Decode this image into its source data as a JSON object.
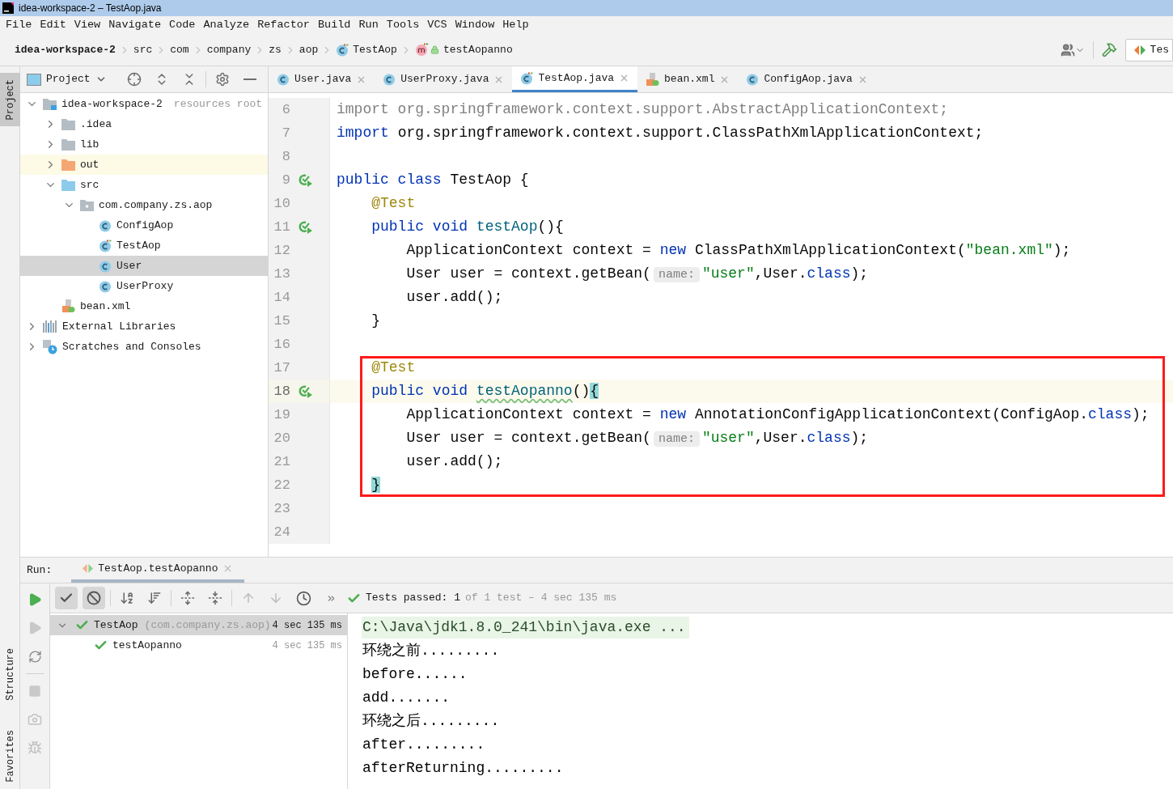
{
  "window": {
    "title": "idea-workspace-2 – TestAop.java"
  },
  "menu": [
    "File",
    "Edit",
    "View",
    "Navigate",
    "Code",
    "Analyze",
    "Refactor",
    "Build",
    "Run",
    "Tools",
    "VCS",
    "Window",
    "Help"
  ],
  "breadcrumbs": [
    {
      "label": "idea-workspace-2",
      "kind": "root"
    },
    {
      "label": "src",
      "kind": "folder"
    },
    {
      "label": "com",
      "kind": "folder"
    },
    {
      "label": "company",
      "kind": "folder"
    },
    {
      "label": "zs",
      "kind": "folder"
    },
    {
      "label": "aop",
      "kind": "folder"
    },
    {
      "label": "TestAop",
      "kind": "test-class"
    },
    {
      "label": "testAopanno",
      "kind": "method"
    }
  ],
  "toolbar": {
    "run_config": "Tes"
  },
  "tool_windows_top": [
    {
      "label": "Project",
      "selected": true
    }
  ],
  "tool_windows_bottom": [
    {
      "label": "Structure",
      "selected": false
    },
    {
      "label": "Favorites",
      "selected": false
    }
  ],
  "project_panel": {
    "title": "Project",
    "tree": [
      {
        "label": "idea-workspace-2",
        "kind": "module",
        "note": "resources root",
        "expanded": true,
        "selected": false,
        "children": [
          {
            "label": ".idea",
            "kind": "folder",
            "expanded": false,
            "selected": false
          },
          {
            "label": "lib",
            "kind": "folder",
            "expanded": false,
            "selected": false
          },
          {
            "label": "out",
            "kind": "excluded-folder",
            "expanded": false,
            "selected": false
          },
          {
            "label": "src",
            "kind": "source-folder",
            "expanded": true,
            "selected": false,
            "children": [
              {
                "label": "com.company.zs.aop",
                "kind": "package",
                "expanded": true,
                "selected": false,
                "children": [
                  {
                    "label": "ConfigAop",
                    "kind": "class",
                    "selected": false
                  },
                  {
                    "label": "TestAop",
                    "kind": "test-class",
                    "selected": false
                  },
                  {
                    "label": "User",
                    "kind": "class",
                    "selected": true
                  },
                  {
                    "label": "UserProxy",
                    "kind": "class",
                    "selected": false
                  }
                ]
              }
            ]
          },
          {
            "label": "bean.xml",
            "kind": "xml",
            "selected": false
          }
        ]
      },
      {
        "label": "External Libraries",
        "kind": "libraries",
        "expanded": false,
        "selected": false
      },
      {
        "label": "Scratches and Consoles",
        "kind": "scratches",
        "expanded": false,
        "selected": false
      }
    ]
  },
  "editor_tabs": [
    {
      "label": "User.java",
      "kind": "class",
      "selected": false
    },
    {
      "label": "UserProxy.java",
      "kind": "class",
      "selected": false
    },
    {
      "label": "TestAop.java",
      "kind": "test-class",
      "selected": true
    },
    {
      "label": "bean.xml",
      "kind": "xml",
      "selected": false
    },
    {
      "label": "ConfigAop.java",
      "kind": "class",
      "selected": false
    }
  ],
  "code_lines": [
    {
      "number": "6",
      "run": false,
      "current": false,
      "boxed": false,
      "tokens": [
        {
          "kind": "unused",
          "text": "import org.springframework.context.support.AbstractApplicationContext;"
        }
      ]
    },
    {
      "number": "7",
      "run": false,
      "current": false,
      "boxed": false,
      "tokens": [
        {
          "kind": "keyword",
          "text": "import"
        },
        {
          "kind": "plain",
          "text": " org.springframework.context.support.ClassPathXmlApplicationContext;"
        }
      ]
    },
    {
      "number": "8",
      "run": false,
      "current": false,
      "boxed": false
    },
    {
      "number": "9",
      "run": true,
      "current": false,
      "boxed": false,
      "tokens": [
        {
          "kind": "keyword",
          "text": "public class"
        },
        {
          "kind": "plain",
          "text": " TestAop {"
        }
      ]
    },
    {
      "number": "10",
      "run": false,
      "current": false,
      "boxed": false,
      "tokens": [
        {
          "kind": "annotation",
          "text": "    @Test"
        }
      ]
    },
    {
      "number": "11",
      "run": true,
      "current": false,
      "boxed": false,
      "tokens": [
        {
          "kind": "keyword",
          "text": "    public void "
        },
        {
          "kind": "method",
          "text": "testAop"
        },
        {
          "kind": "plain",
          "text": "(){"
        }
      ]
    },
    {
      "number": "12",
      "run": false,
      "current": false,
      "boxed": false,
      "tokens": [
        {
          "kind": "plain",
          "text": "        ApplicationContext context = "
        },
        {
          "kind": "keyword",
          "text": "new"
        },
        {
          "kind": "plain",
          "text": " ClassPathXmlApplicationContext("
        },
        {
          "kind": "string",
          "text": "\"bean.xml\""
        },
        {
          "kind": "plain",
          "text": ");"
        }
      ]
    },
    {
      "number": "13",
      "run": false,
      "current": false,
      "boxed": false,
      "tokens": [
        {
          "kind": "plain",
          "text": "        User user = context.getBean("
        },
        {
          "kind": "hint",
          "text": "name:"
        },
        {
          "kind": "string",
          "text": "\"user\""
        },
        {
          "kind": "plain",
          "text": ",User."
        },
        {
          "kind": "keyword",
          "text": "class"
        },
        {
          "kind": "plain",
          "text": ");"
        }
      ]
    },
    {
      "number": "14",
      "run": false,
      "current": false,
      "boxed": false,
      "tokens": [
        {
          "kind": "plain",
          "text": "        user.add();"
        }
      ]
    },
    {
      "number": "15",
      "run": false,
      "current": false,
      "boxed": false,
      "tokens": [
        {
          "kind": "plain",
          "text": "    }"
        }
      ]
    },
    {
      "number": "16",
      "run": false,
      "current": false,
      "boxed": false
    },
    {
      "number": "17",
      "run": false,
      "current": false,
      "boxed": true,
      "tokens": [
        {
          "kind": "annotation",
          "text": "    @Test"
        }
      ]
    },
    {
      "number": "18",
      "run": true,
      "current": true,
      "boxed": true,
      "tokens": [
        {
          "kind": "keyword",
          "text": "    public void "
        },
        {
          "kind": "method-warning",
          "text": "testAopanno"
        },
        {
          "kind": "plain",
          "text": "()"
        },
        {
          "kind": "brace-match",
          "text": "{"
        }
      ]
    },
    {
      "number": "19",
      "run": false,
      "current": false,
      "boxed": true,
      "tokens": [
        {
          "kind": "plain",
          "text": "        ApplicationContext context = "
        },
        {
          "kind": "keyword",
          "text": "new"
        },
        {
          "kind": "plain",
          "text": " AnnotationConfigApplicationContext(ConfigAop."
        },
        {
          "kind": "keyword",
          "text": "class"
        },
        {
          "kind": "plain",
          "text": ");"
        }
      ]
    },
    {
      "number": "20",
      "run": false,
      "current": false,
      "boxed": true,
      "tokens": [
        {
          "kind": "plain",
          "text": "        User user = context.getBean("
        },
        {
          "kind": "hint",
          "text": "name:"
        },
        {
          "kind": "string",
          "text": "\"user\""
        },
        {
          "kind": "plain",
          "text": ",User."
        },
        {
          "kind": "keyword",
          "text": "class"
        },
        {
          "kind": "plain",
          "text": ");"
        }
      ]
    },
    {
      "number": "21",
      "run": false,
      "current": false,
      "boxed": true,
      "tokens": [
        {
          "kind": "plain",
          "text": "        user.add();"
        }
      ]
    },
    {
      "number": "22",
      "run": false,
      "current": false,
      "boxed": true,
      "tokens": [
        {
          "kind": "brace-match",
          "text": "    }"
        }
      ]
    },
    {
      "number": "23",
      "run": false,
      "current": false,
      "boxed": false
    },
    {
      "number": "24",
      "run": false,
      "current": false,
      "boxed": false
    }
  ],
  "run_panel": {
    "label": "Run:",
    "tabs": [
      {
        "label": "TestAop.testAopanno",
        "selected": true
      }
    ],
    "status": "Tests passed: 1",
    "status_detail": "of 1 test – 4 sec 135 ms",
    "results": [
      {
        "label": "TestAop",
        "package": "(com.company.zs.aop)",
        "time": "4 sec 135 ms",
        "passed": true,
        "expanded": true,
        "selected": true,
        "children": [
          {
            "label": "testAopanno",
            "time": "4 sec 135 ms",
            "passed": true,
            "selected": false
          }
        ]
      }
    ],
    "console": [
      {
        "kind": "command",
        "text": "C:\\Java\\jdk1.8.0_241\\bin\\java.exe ..."
      },
      {
        "kind": "output",
        "text": "环绕之前........."
      },
      {
        "kind": "output",
        "text": "before......"
      },
      {
        "kind": "output",
        "text": "add......."
      },
      {
        "kind": "output",
        "text": "环绕之后........."
      },
      {
        "kind": "output",
        "text": "after........."
      },
      {
        "kind": "output",
        "text": "afterReturning........."
      }
    ]
  }
}
